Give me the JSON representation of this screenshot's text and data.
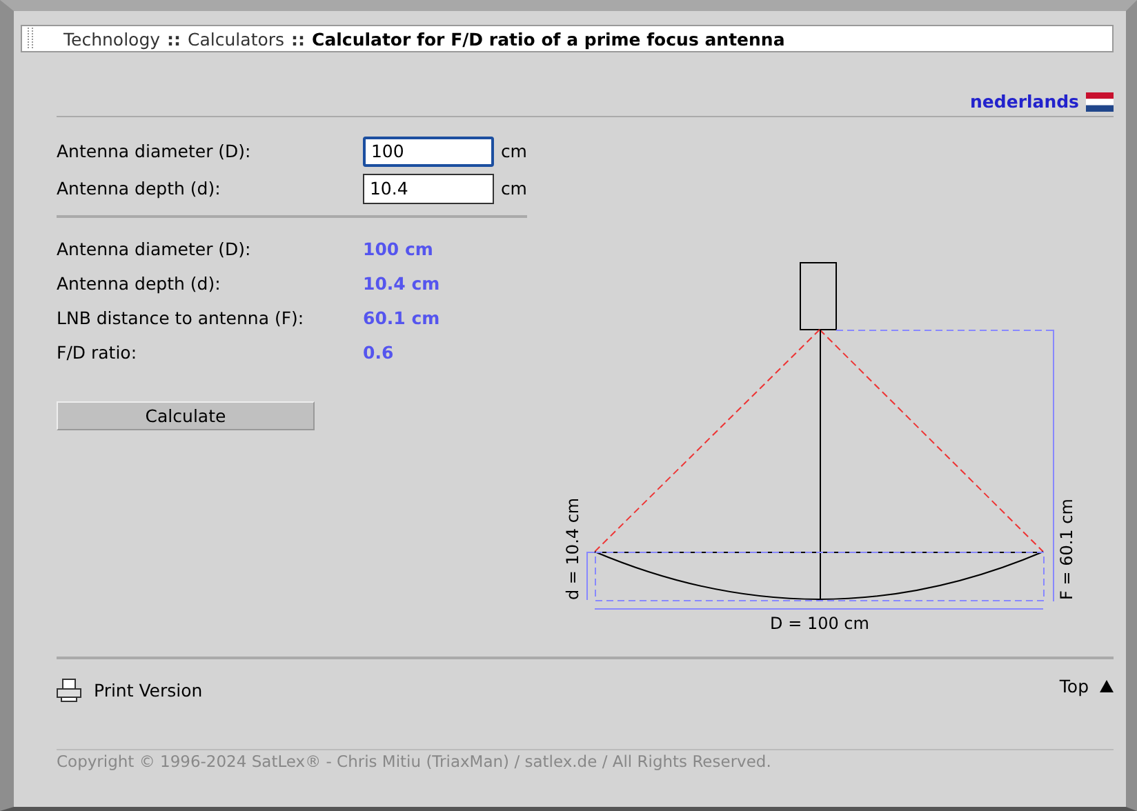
{
  "breadcrumb": [
    {
      "text": "Technology",
      "current": false
    },
    {
      "sep": "::",
      "text": "Calculators",
      "current": false
    },
    {
      "sep": "::",
      "text": "Calculator for F/D ratio of a prime focus antenna",
      "current": true
    }
  ],
  "language": {
    "label": "nederlands"
  },
  "inputs": [
    {
      "label": "Antenna diameter (D):",
      "value": "100",
      "unit": "cm",
      "focused": true
    },
    {
      "label": "Antenna depth (d):",
      "value": "10.4",
      "unit": "cm",
      "focused": false
    }
  ],
  "results": [
    {
      "label": "Antenna diameter (D):",
      "value": "100 cm"
    },
    {
      "label": "Antenna depth (d):",
      "value": "10.4 cm"
    },
    {
      "label": "LNB distance to antenna (F):",
      "value": "60.1 cm"
    },
    {
      "label": "F/D ratio:",
      "value": "0.6"
    }
  ],
  "button": "Calculate",
  "diagram": {
    "depth_label": "d = 10.4 cm",
    "focal_label": "F = 60.1 cm",
    "diameter_label": "D = 100 cm"
  },
  "footer": {
    "print": "Print Version",
    "top": "Top",
    "copyright": "Copyright © 1996-2024 SatLex® - Chris Mitiu (TriaxMan) / satlex.de / All Rights Reserved."
  }
}
